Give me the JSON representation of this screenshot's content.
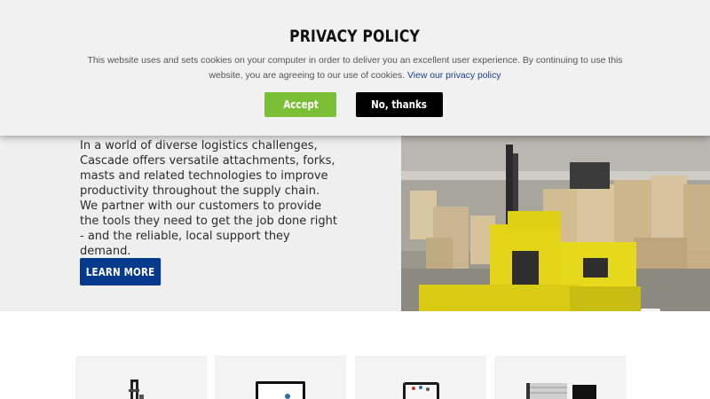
{
  "cookie_banner": {
    "title": "PRIVACY POLICY",
    "text": "This website uses and sets cookies on your computer in order to deliver you an excellent user experience. By continuing to use this website, you are agreeing to our use of cookies.",
    "link_label": "View our privacy policy",
    "accept_label": "Accept",
    "decline_label": "No, thanks",
    "accept_color": "#7bbf37",
    "decline_color": "#000000"
  },
  "hero": {
    "body": "In a world of diverse logistics challenges, Cascade offers versatile attachments, forks, masts and related technologies to improve productivity throughout the supply chain. We partner with our customers to provide the tools they need to get the job done right - and the reliable, local support they demand.",
    "cta_label": "LEARN MORE",
    "cta_color": "#063a8c"
  },
  "product_cards": [
    {
      "icon": "fork-attachment-icon"
    },
    {
      "icon": "monitor-icon"
    },
    {
      "icon": "tablet-icon"
    },
    {
      "icon": "storage-rack-icon"
    }
  ]
}
